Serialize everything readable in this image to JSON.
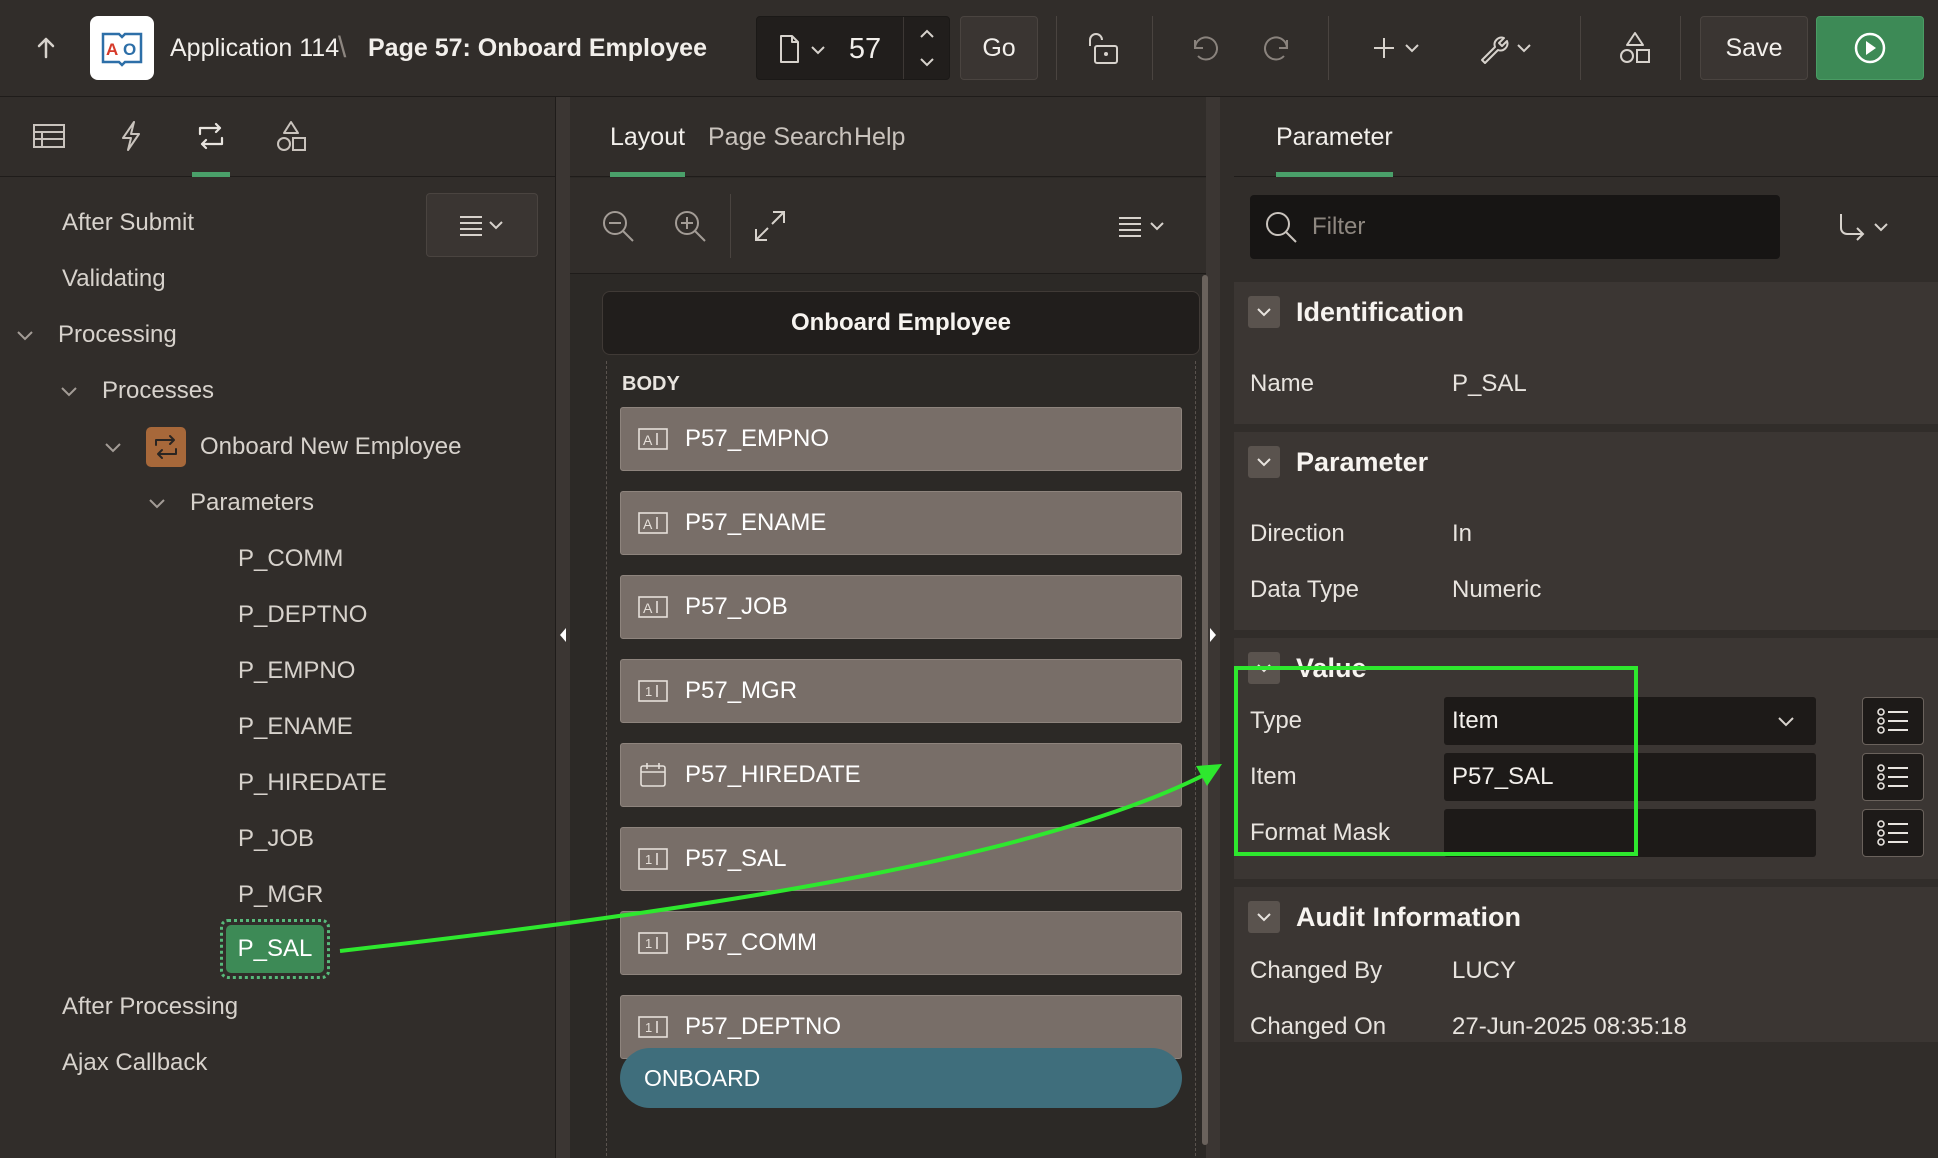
{
  "header": {
    "app_title": "Application 114",
    "separator": "\\",
    "page_title": "Page 57: Onboard Employee",
    "page_number": "57",
    "go_label": "Go",
    "save_label": "Save"
  },
  "left": {
    "tree_items": [
      {
        "label": "After Submit"
      },
      {
        "label": "Validating"
      },
      {
        "label": "Processing"
      },
      {
        "label": "Processes"
      },
      {
        "label": "Onboard New Employee"
      },
      {
        "label": "Parameters"
      },
      {
        "label": "P_COMM"
      },
      {
        "label": "P_DEPTNO"
      },
      {
        "label": "P_EMPNO"
      },
      {
        "label": "P_ENAME"
      },
      {
        "label": "P_HIREDATE"
      },
      {
        "label": "P_JOB"
      },
      {
        "label": "P_MGR"
      },
      {
        "label": "P_SAL"
      },
      {
        "label": "After Processing"
      },
      {
        "label": "Ajax Callback"
      }
    ]
  },
  "middle": {
    "tabs": [
      "Layout",
      "Page Search",
      "Help"
    ],
    "region_title": "Onboard Employee",
    "body_label": "BODY",
    "items": [
      {
        "label": "P57_EMPNO",
        "icon": "text-field-icon"
      },
      {
        "label": "P57_ENAME",
        "icon": "text-field-icon"
      },
      {
        "label": "P57_JOB",
        "icon": "text-field-icon"
      },
      {
        "label": "P57_MGR",
        "icon": "number-field-icon"
      },
      {
        "label": "P57_HIREDATE",
        "icon": "date-picker-icon"
      },
      {
        "label": "P57_SAL",
        "icon": "number-field-icon"
      },
      {
        "label": "P57_COMM",
        "icon": "number-field-icon"
      },
      {
        "label": "P57_DEPTNO",
        "icon": "number-field-icon"
      }
    ],
    "button_label": "ONBOARD"
  },
  "right": {
    "tab": "Parameter",
    "filter_placeholder": "Filter",
    "sections": {
      "identification": {
        "title": "Identification",
        "name_label": "Name",
        "name_value": "P_SAL"
      },
      "parameter": {
        "title": "Parameter",
        "direction_label": "Direction",
        "direction_value": "In",
        "datatype_label": "Data Type",
        "datatype_value": "Numeric"
      },
      "value": {
        "title": "Value",
        "type_label": "Type",
        "type_value": "Item",
        "item_label": "Item",
        "item_value": "P57_SAL",
        "format_label": "Format Mask",
        "format_value": ""
      },
      "audit": {
        "title": "Audit Information",
        "changed_by_label": "Changed By",
        "changed_by_value": "LUCY",
        "changed_on_label": "Changed On",
        "changed_on_value": "27-Jun-2025 08:35:18"
      }
    }
  },
  "colors": {
    "accent_green": "#4aa06a",
    "selected_node": "#3d8a56",
    "annotation_green": "#2ee82e",
    "button_teal": "#3f6e7c"
  }
}
